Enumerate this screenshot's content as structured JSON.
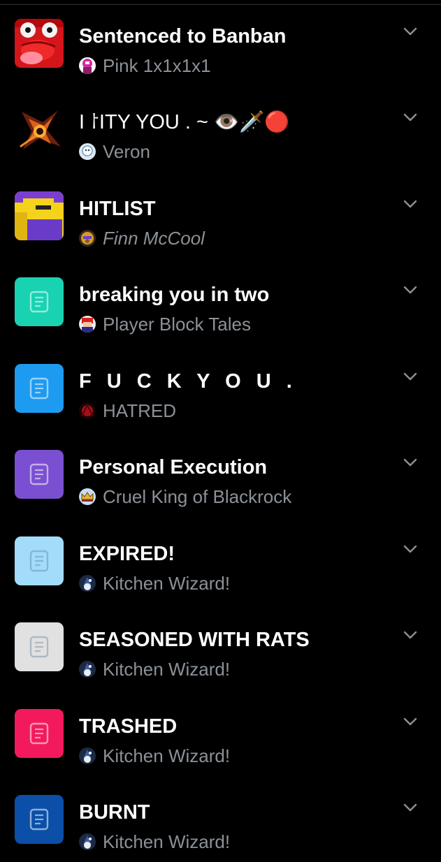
{
  "playlists": [
    {
      "title": "Sentenced to Banban",
      "creator": "Pink 1x1x1x1",
      "thumb_kind": "image-red-creature",
      "avatar_kind": "pink-avatar",
      "thumb_color": "#d4161b",
      "creator_italic": false
    },
    {
      "title": "I ⸷ITY YOU . ~ 👁️🗡️🔴",
      "creator": "Veron",
      "thumb_kind": "image-dark-art",
      "avatar_kind": "white-avatar",
      "thumb_color": "#2a0d08",
      "creator_italic": false
    },
    {
      "title": "HITLIST",
      "creator": "Finn McCool",
      "thumb_kind": "image-blocky-character",
      "avatar_kind": "gold-avatar",
      "thumb_color": "#5b2fb5",
      "creator_italic": true
    },
    {
      "title": "breaking you in two",
      "creator": "Player Block Tales",
      "thumb_kind": "document-icon",
      "avatar_kind": "red-avatar",
      "thumb_color": "#18d2b2",
      "creator_italic": false
    },
    {
      "title": "F U C K Y O U .",
      "creator": "HATRED",
      "thumb_kind": "document-icon",
      "avatar_kind": "dark-red-avatar",
      "thumb_color": "#1d9bf0",
      "creator_italic": false
    },
    {
      "title": "Personal Execution",
      "creator": "Cruel King of Blackrock",
      "thumb_kind": "document-icon",
      "avatar_kind": "crown-avatar",
      "thumb_color": "#7b4fd1",
      "creator_italic": false
    },
    {
      "title": "EXPIRED!",
      "creator": "Kitchen Wizard!",
      "thumb_kind": "document-icon",
      "avatar_kind": "wizard-avatar",
      "thumb_color": "#a3dcfb",
      "creator_italic": false
    },
    {
      "title": "SEASONED WITH RATS",
      "creator": "Kitchen Wizard!",
      "thumb_kind": "document-icon",
      "avatar_kind": "wizard-avatar",
      "thumb_color": "#e1e1e1",
      "creator_italic": false
    },
    {
      "title": "TRASHED",
      "creator": "Kitchen Wizard!",
      "thumb_kind": "document-icon",
      "avatar_kind": "wizard-avatar",
      "thumb_color": "#f21a5c",
      "creator_italic": false
    },
    {
      "title": "BURNT",
      "creator": "Kitchen Wizard!",
      "thumb_kind": "document-icon",
      "avatar_kind": "wizard-avatar",
      "thumb_color": "#0b4fa8",
      "creator_italic": false
    }
  ],
  "chevron_icon": "chevron-down-icon",
  "document_icon": "document-icon"
}
